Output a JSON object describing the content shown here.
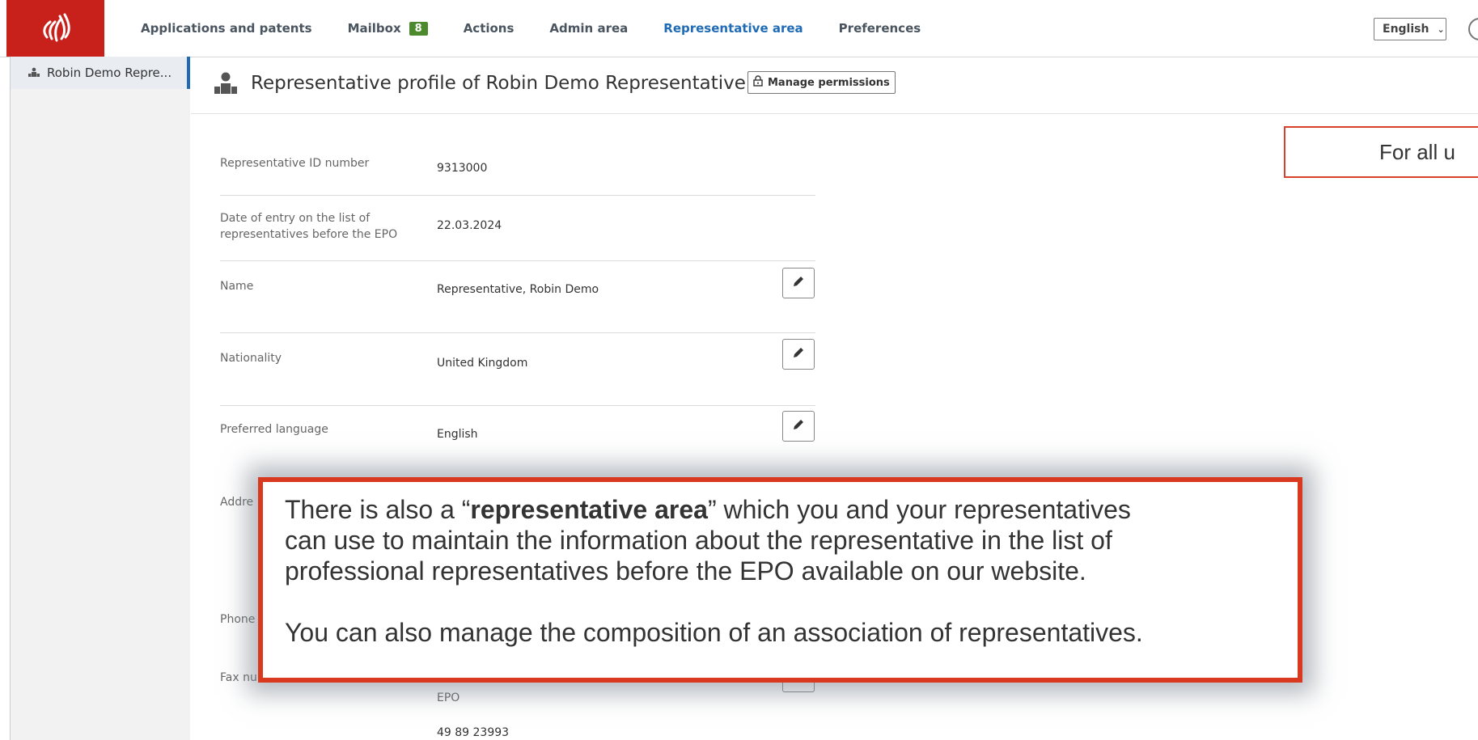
{
  "nav": {
    "items": [
      {
        "label": "Applications and patents",
        "active": false
      },
      {
        "label": "Mailbox",
        "badge": "8",
        "active": false
      },
      {
        "label": "Actions",
        "active": false
      },
      {
        "label": "Admin area",
        "active": false
      },
      {
        "label": "Representative area",
        "active": true
      },
      {
        "label": "Preferences",
        "active": false
      }
    ],
    "language": "English"
  },
  "sidebar": {
    "items": [
      {
        "label": "Robin Demo Repre..."
      }
    ]
  },
  "header": {
    "title": "Representative profile of Robin Demo Representative",
    "manage_label": "Manage permissions"
  },
  "profile": {
    "rows": [
      {
        "label": "Representative ID number",
        "value": "9313000"
      },
      {
        "label": "Date of entry on the list of representatives before the EPO",
        "value": "22.03.2024"
      },
      {
        "label": "Name",
        "value": "Representative, Robin Demo"
      },
      {
        "label": "Nationality",
        "value": "United Kingdom"
      },
      {
        "label": "Preferred language",
        "value": "English"
      }
    ],
    "address_label": "Addre",
    "phone_label": "Phone",
    "fax_label": "Fax nu",
    "fax_value_tail": "EPO",
    "phone_number": "49 89 23993"
  },
  "overlay": {
    "partial_text": "For all u",
    "callout": {
      "pre": "There is also a “",
      "bold": "representative area",
      "post": "” which you and your representatives",
      "line2": "can use to maintain the information about the representative in the list of",
      "line3": "professional representatives before the EPO available on our website.",
      "line4": "You can also manage the composition of an association of representatives."
    }
  },
  "colors": {
    "brand_red": "#c8211c",
    "active_blue": "#1f6bb5",
    "badge_green": "#4d8a2e",
    "callout_border": "#d8391f"
  },
  "icons": [
    "epo-logo-icon",
    "user-group-icon",
    "lock-icon",
    "pencil-icon",
    "chevron-down-icon",
    "user-circle-icon"
  ]
}
